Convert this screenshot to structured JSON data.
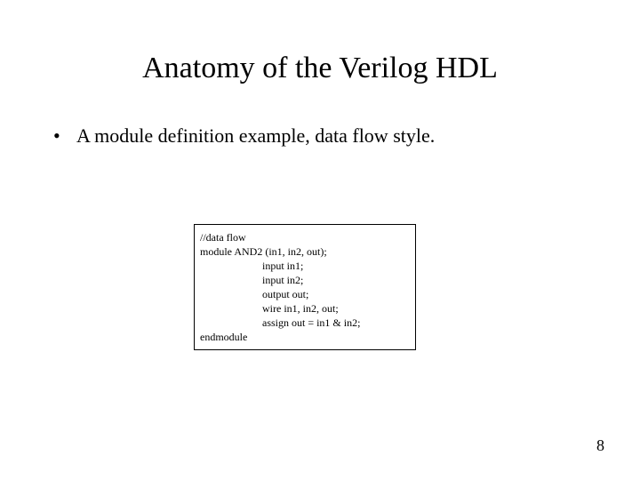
{
  "title": "Anatomy of the Verilog HDL",
  "bullet": {
    "marker": "•",
    "text": "A module definition example, data flow style."
  },
  "code": {
    "comment": "//data flow",
    "module_decl": "module AND2 (in1, in2, out);",
    "lines": [
      "input in1;",
      "input in2;",
      "output out;",
      "wire in1, in2, out;",
      "assign out = in1 & in2;"
    ],
    "endmodule": "endmodule"
  },
  "page_number": "8"
}
